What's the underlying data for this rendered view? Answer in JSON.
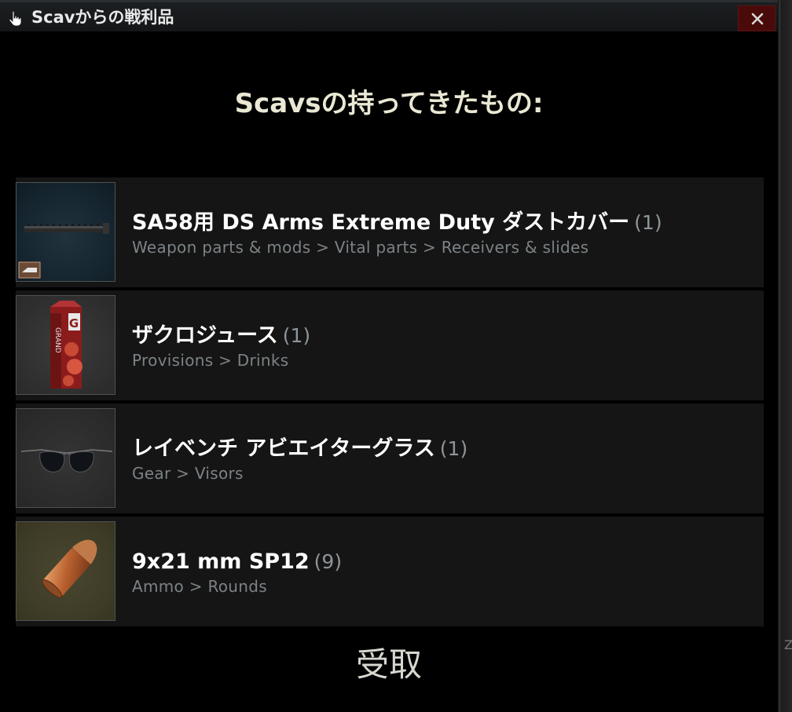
{
  "window": {
    "title": "Scavからの戦利品",
    "close_glyph": "✕"
  },
  "heading": "Scavsの持ってきたもの:",
  "items": [
    {
      "name": "SA58用 DS Arms Extreme Duty ダストカバー",
      "count": "(1)",
      "category": "Weapon parts & mods > Vital parts > Receivers & slides",
      "icon": "dust-cover-icon"
    },
    {
      "name": "ザクロジュース",
      "count": "(1)",
      "category": "Provisions > Drinks",
      "icon": "juice-carton-icon"
    },
    {
      "name": "レイベンチ アビエイターグラス",
      "count": "(1)",
      "category": "Gear > Visors",
      "icon": "aviator-glasses-icon"
    },
    {
      "name": "9x21 mm SP12",
      "count": "(9)",
      "category": "Ammo > Rounds",
      "icon": "bullet-round-icon"
    }
  ],
  "receive_button": "受取",
  "colors": {
    "background": "#000000",
    "item_row": "#151515",
    "heading": "#eae8d4",
    "category_text": "#7c8286",
    "close_button": "#4a0a0a"
  }
}
